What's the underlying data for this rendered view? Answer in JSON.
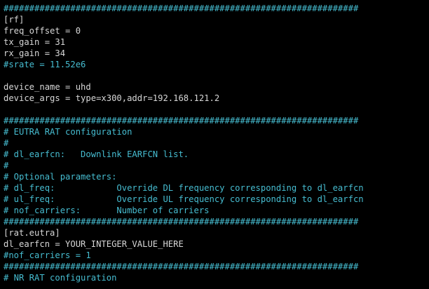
{
  "terminal": {
    "lines": [
      {
        "type": "comment",
        "text": "#####################################################################"
      },
      {
        "type": "comment",
        "text": "#####################################################################"
      },
      {
        "type": "text",
        "text": "[rf]"
      },
      {
        "type": "text",
        "text": "freq_offset = 0"
      },
      {
        "type": "text",
        "text": "tx_gain = 31"
      },
      {
        "type": "text",
        "text": "rx_gain = 34"
      },
      {
        "type": "comment",
        "text": "#srate = 11.52e6"
      },
      {
        "type": "blank",
        "text": ""
      },
      {
        "type": "text",
        "text": "device_name = uhd"
      },
      {
        "type": "text",
        "text": "device_args = type=x300,addr=192.168.121.2"
      },
      {
        "type": "blank",
        "text": ""
      },
      {
        "type": "comment",
        "text": "#####################################################################"
      },
      {
        "type": "comment",
        "text": "# EUTRA RAT configuration"
      },
      {
        "type": "comment",
        "text": "#"
      },
      {
        "type": "comment",
        "text": "# dl_earfcn:   Downlink EARFCN list."
      },
      {
        "type": "comment",
        "text": "#"
      },
      {
        "type": "comment",
        "text": "# Optional parameters:"
      },
      {
        "type": "comment",
        "text": "# dl_freq:            Override DL frequency corresponding to dl_earfcn"
      },
      {
        "type": "comment",
        "text": "# ul_freq:            Override UL frequency corresponding to dl_earfcn"
      },
      {
        "type": "comment",
        "text": "# nof_carriers:       Number of carriers"
      },
      {
        "type": "comment",
        "text": "#####################################################################"
      },
      {
        "type": "text",
        "text": "[rat.eutra]"
      },
      {
        "type": "text",
        "text": "dl_earfcn = YOUR_INTEGER_VALUE_HERE"
      },
      {
        "type": "comment",
        "text": "#nof_carriers = 1"
      },
      {
        "type": "comment",
        "text": "#####################################################################"
      },
      {
        "type": "comment",
        "text": "# NR RAT configuration"
      }
    ]
  }
}
